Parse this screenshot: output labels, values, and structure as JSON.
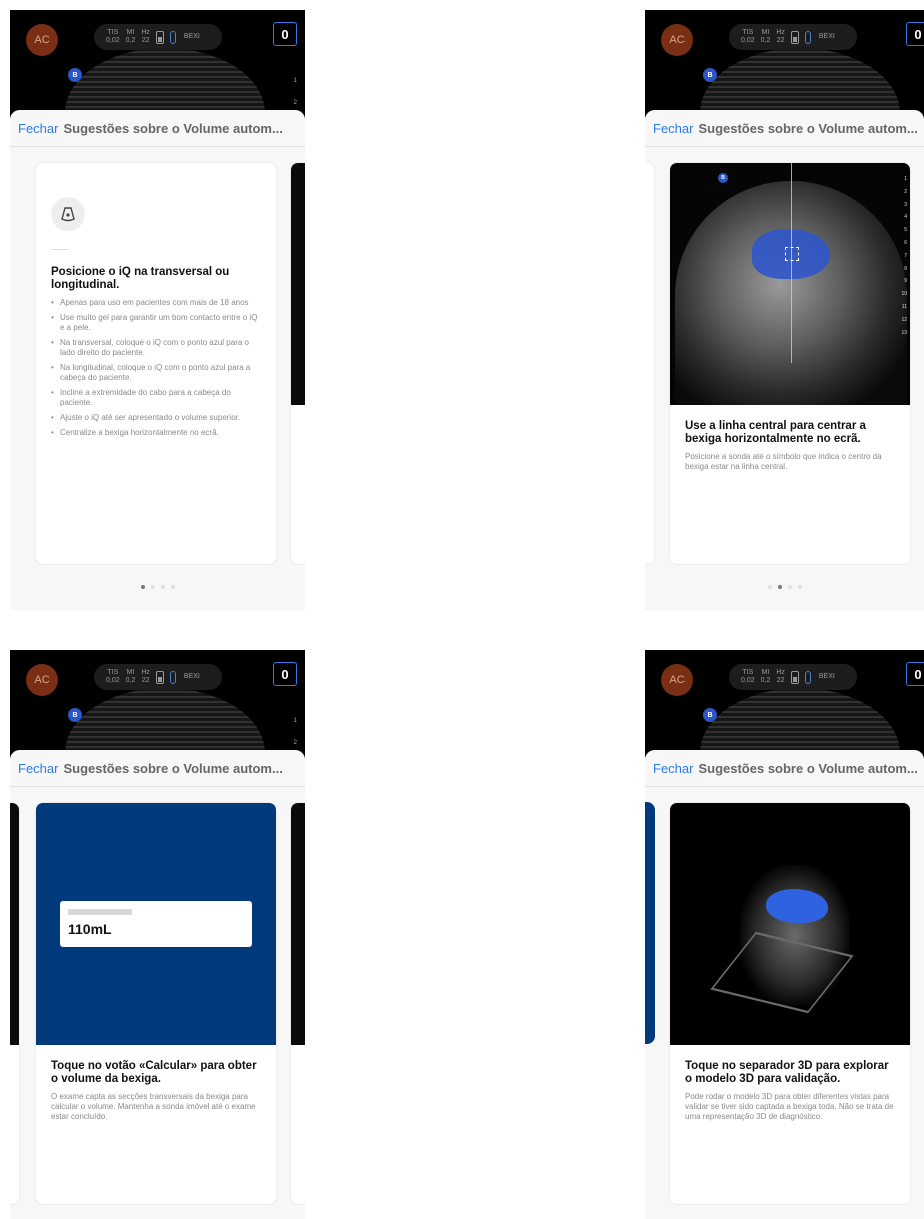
{
  "status_bar": {
    "avatar_initials": "AC",
    "tis_label": "TIS",
    "tis_value": "0,02",
    "mi_label": "MI",
    "mi_value": "0,2",
    "hz_label": "Hz",
    "hz_value": "22",
    "preset": "BEXI",
    "freeze_value": "0",
    "orientation_marker": "B",
    "depth_ticks": [
      "1",
      "2"
    ]
  },
  "sheet": {
    "close_label": "Fechar",
    "title": "Sugestões sobre o Volume autom..."
  },
  "steps": [
    {
      "heading": "Posicione o iQ na transversal ou longitudinal.",
      "icon": "probe-icon",
      "bullets": [
        "Apenas para uso em pacientes com mais de 18 anos",
        "Use muito gel para garantir um bom contacto entre o iQ e a pele.",
        "Na transversal, coloque o iQ com o ponto azul para o lado direito do paciente.",
        "Na longitudinal, coloque o iQ com o ponto azul para a cabeça do paciente.",
        "Incline a extremidade do cabo para a cabeça do paciente.",
        "Ajuste o iQ até ser apresentado o volume superior.",
        "Centralize a bexiga horizontalmente no ecrã."
      ]
    },
    {
      "heading": "Use a linha central para centrar a bexiga horizontalmente no ecrã.",
      "body": "Posicione a sonda até o símbolo que indica o centro da bexiga estar na linha central.",
      "image_marker": "B",
      "depth_ticks": [
        "1",
        "2",
        "3",
        "4",
        "5",
        "6",
        "7",
        "8",
        "9",
        "10",
        "11",
        "12",
        "13"
      ]
    },
    {
      "heading": "Toque no votão «Calcular» para obter o volume da bexiga.",
      "body": "O exame capta as secções transversais da bexiga para calcular o volume. Mantenha a sonda imóvel até o exame estar concluído.",
      "volume": "110mL"
    },
    {
      "heading": "Toque no separador 3D para explorar o modelo 3D para validação.",
      "body": "Pode rodar o modelo 3D para obter diferentes vistas para validar se tiver sido captada a bexiga toda. Não se trata de uma representação 3D de diagnóstico."
    }
  ],
  "colors": {
    "accent": "#2e7ae6",
    "volume_bg": "#003a7a",
    "bladder": "#2f57c9"
  }
}
